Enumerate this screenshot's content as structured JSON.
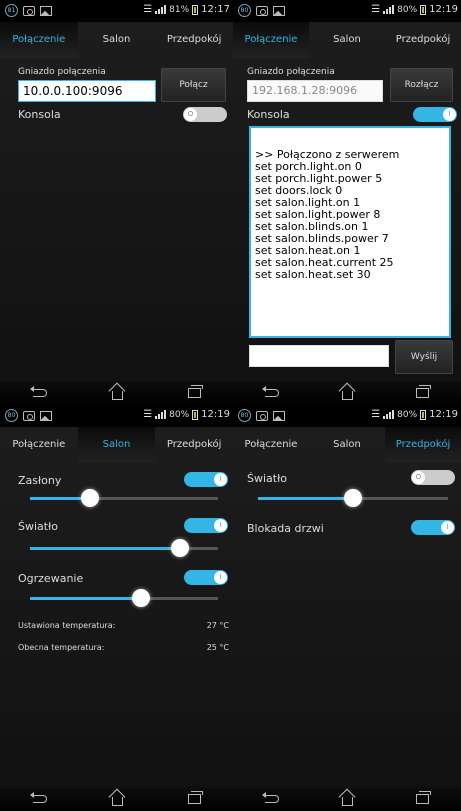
{
  "colors": {
    "accent": "#33b5e5",
    "toggle_off": "#cccccc"
  },
  "panels": [
    {
      "status": {
        "notif": "81",
        "battery": "81%",
        "time": "12:17"
      },
      "tabs": [
        "Połączenie",
        "Salon",
        "Przedpokój"
      ],
      "active_tab": 0,
      "connection": {
        "socket_label": "Gniazdo połączenia",
        "address": "10.0.0.100:9096",
        "button": "Połącz",
        "console_label": "Konsola",
        "console_toggle": "off"
      }
    },
    {
      "status": {
        "notif": "80",
        "battery": "80%",
        "time": "12:19"
      },
      "tabs": [
        "Połączenie",
        "Salon",
        "Przedpokój"
      ],
      "active_tab": 0,
      "connection": {
        "socket_label": "Gniazdo połączenia",
        "address": "192.168.1.28:9096",
        "button": "Rozłącz",
        "console_label": "Konsola",
        "console_toggle": "on",
        "console_intro": ">> Połączono z serwerem",
        "console_lines": [
          "set porch.light.on 0",
          "set porch.light.power 5",
          "set doors.lock 0",
          "set salon.light.on 1",
          "set salon.light.power 8",
          "set salon.blinds.on 1",
          "set salon.blinds.power 7",
          "set salon.heat.on 1",
          "set salon.heat.current 25",
          "set salon.heat.set 30"
        ],
        "send_input": "",
        "send_button": "Wyślij"
      }
    },
    {
      "status": {
        "notif": "80",
        "battery": "80%",
        "time": "12:19"
      },
      "tabs": [
        "Połączenie",
        "Salon",
        "Przedpokój"
      ],
      "active_tab": 1,
      "salon": {
        "blinds": {
          "label": "Zasłony",
          "toggle": "on",
          "level": 0.32
        },
        "light": {
          "label": "Światło",
          "toggle": "on",
          "level": 0.8
        },
        "heating": {
          "label": "Ogrzewanie",
          "toggle": "on",
          "level": 0.59
        },
        "set_temp": {
          "label": "Ustawiona temperatura:",
          "value": "27 °C"
        },
        "current_temp": {
          "label": "Obecna temperatura:",
          "value": "25 °C"
        }
      }
    },
    {
      "status": {
        "notif": "80",
        "battery": "80%",
        "time": "12:19"
      },
      "tabs": [
        "Połączenie",
        "Salon",
        "Przedpokój"
      ],
      "active_tab": 2,
      "hall": {
        "light": {
          "label": "Światło",
          "toggle": "off",
          "level": 0.5
        },
        "door_lock": {
          "label": "Blokada drzwi",
          "toggle": "on"
        }
      }
    }
  ]
}
